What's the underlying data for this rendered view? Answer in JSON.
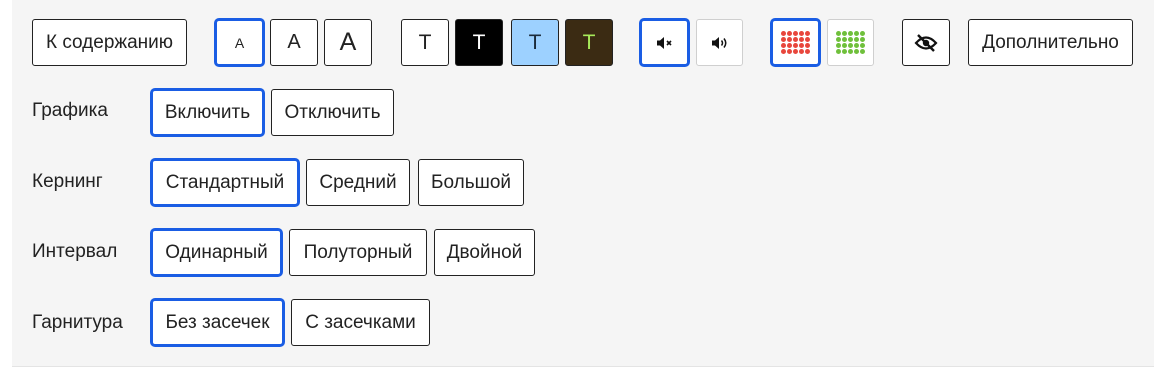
{
  "toolbar": {
    "skip_label": "К содержанию",
    "font_size_small": "A",
    "font_size_medium": "A",
    "font_size_large": "A",
    "theme_white": "T",
    "theme_black": "T",
    "theme_blue": "T",
    "theme_brown": "T",
    "more_label": "Дополнительно"
  },
  "colors": {
    "accent": "#1a5de4",
    "theme_black_bg": "#000000",
    "theme_blue_bg": "#9dd1ff",
    "theme_brown_bg": "#3b2b13",
    "theme_brown_fg": "#a7ea5a",
    "images_off_dots": "#e8463c",
    "images_on_dots": "#6fc03b"
  },
  "settings": {
    "graphics": {
      "label": "Графика",
      "on": "Включить",
      "off": "Отключить"
    },
    "kerning": {
      "label": "Кернинг",
      "standard": "Стандартный",
      "medium": "Средний",
      "large": "Большой"
    },
    "interval": {
      "label": "Интервал",
      "single": "Одинарный",
      "one_half": "Полуторный",
      "double": "Двойной"
    },
    "typeface": {
      "label": "Гарнитура",
      "sans": "Без засечек",
      "serif": "С засечками"
    }
  }
}
